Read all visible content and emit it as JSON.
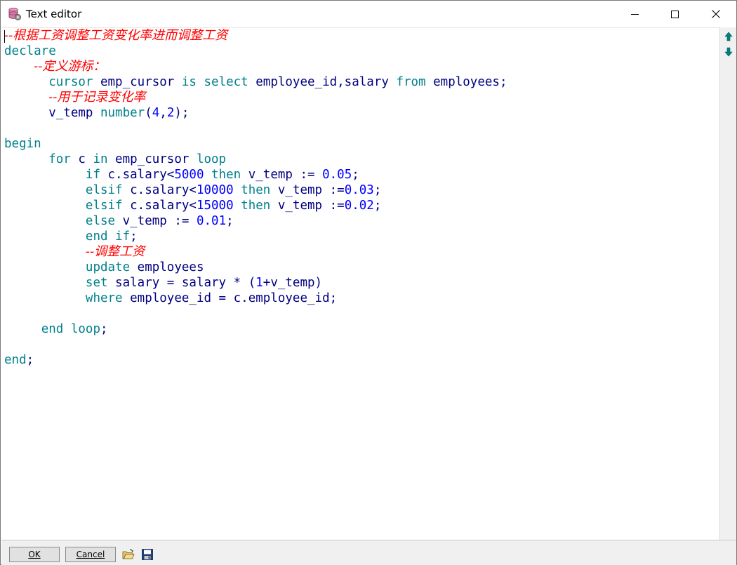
{
  "window": {
    "title": "Text editor",
    "icon": "database-icon"
  },
  "editor": {
    "lines": [
      {
        "indent": "",
        "segments": [
          {
            "t": "--根据工资调整工资变化率进而调整工资",
            "c": "cmt"
          }
        ]
      },
      {
        "indent": "",
        "segments": [
          {
            "t": "declare",
            "c": "kw"
          }
        ]
      },
      {
        "indent": "    ",
        "segments": [
          {
            "t": "--定义游标：",
            "c": "cmt"
          }
        ]
      },
      {
        "indent": "      ",
        "segments": [
          {
            "t": "cursor",
            "c": "kw"
          },
          {
            "t": " emp_cursor ",
            "c": "id"
          },
          {
            "t": "is",
            "c": "kw"
          },
          {
            "t": " ",
            "c": "id"
          },
          {
            "t": "select",
            "c": "kw"
          },
          {
            "t": " employee_id,salary ",
            "c": "id"
          },
          {
            "t": "from",
            "c": "kw"
          },
          {
            "t": " employees;",
            "c": "id"
          }
        ]
      },
      {
        "indent": "      ",
        "segments": [
          {
            "t": "--用于记录变化率",
            "c": "cmt"
          }
        ]
      },
      {
        "indent": "      ",
        "segments": [
          {
            "t": "v_temp ",
            "c": "id"
          },
          {
            "t": "number",
            "c": "kw"
          },
          {
            "t": "(",
            "c": "id"
          },
          {
            "t": "4",
            "c": "num"
          },
          {
            "t": ",",
            "c": "id"
          },
          {
            "t": "2",
            "c": "num"
          },
          {
            "t": ");",
            "c": "id"
          }
        ]
      },
      {
        "indent": "",
        "segments": []
      },
      {
        "indent": "",
        "segments": [
          {
            "t": "begin",
            "c": "kw"
          }
        ]
      },
      {
        "indent": "      ",
        "segments": [
          {
            "t": "for",
            "c": "kw"
          },
          {
            "t": " c ",
            "c": "id"
          },
          {
            "t": "in",
            "c": "kw"
          },
          {
            "t": " emp_cursor ",
            "c": "id"
          },
          {
            "t": "loop",
            "c": "kw"
          }
        ]
      },
      {
        "indent": "           ",
        "segments": [
          {
            "t": "if",
            "c": "kw"
          },
          {
            "t": " c.salary<",
            "c": "id"
          },
          {
            "t": "5000",
            "c": "num"
          },
          {
            "t": " ",
            "c": "id"
          },
          {
            "t": "then",
            "c": "kw"
          },
          {
            "t": " v_temp := ",
            "c": "id"
          },
          {
            "t": "0.05",
            "c": "num"
          },
          {
            "t": ";",
            "c": "id"
          }
        ]
      },
      {
        "indent": "           ",
        "segments": [
          {
            "t": "elsif",
            "c": "kw"
          },
          {
            "t": " c.salary<",
            "c": "id"
          },
          {
            "t": "10000",
            "c": "num"
          },
          {
            "t": " ",
            "c": "id"
          },
          {
            "t": "then",
            "c": "kw"
          },
          {
            "t": " v_temp :=",
            "c": "id"
          },
          {
            "t": "0.03",
            "c": "num"
          },
          {
            "t": ";",
            "c": "id"
          }
        ]
      },
      {
        "indent": "           ",
        "segments": [
          {
            "t": "elsif",
            "c": "kw"
          },
          {
            "t": " c.salary<",
            "c": "id"
          },
          {
            "t": "15000",
            "c": "num"
          },
          {
            "t": " ",
            "c": "id"
          },
          {
            "t": "then",
            "c": "kw"
          },
          {
            "t": " v_temp :=",
            "c": "id"
          },
          {
            "t": "0.02",
            "c": "num"
          },
          {
            "t": ";",
            "c": "id"
          }
        ]
      },
      {
        "indent": "           ",
        "segments": [
          {
            "t": "else",
            "c": "kw"
          },
          {
            "t": " v_temp := ",
            "c": "id"
          },
          {
            "t": "0.01",
            "c": "num"
          },
          {
            "t": ";",
            "c": "id"
          }
        ]
      },
      {
        "indent": "           ",
        "segments": [
          {
            "t": "end",
            "c": "kw"
          },
          {
            "t": " ",
            "c": "id"
          },
          {
            "t": "if",
            "c": "kw"
          },
          {
            "t": ";",
            "c": "id"
          }
        ]
      },
      {
        "indent": "           ",
        "segments": [
          {
            "t": "--调整工资",
            "c": "cmt"
          }
        ]
      },
      {
        "indent": "           ",
        "segments": [
          {
            "t": "update",
            "c": "kw"
          },
          {
            "t": " employees",
            "c": "id"
          }
        ]
      },
      {
        "indent": "           ",
        "segments": [
          {
            "t": "set",
            "c": "kw"
          },
          {
            "t": " salary = salary * (",
            "c": "id"
          },
          {
            "t": "1",
            "c": "num"
          },
          {
            "t": "+v_temp)",
            "c": "id"
          }
        ]
      },
      {
        "indent": "           ",
        "segments": [
          {
            "t": "where",
            "c": "kw"
          },
          {
            "t": " employee_id = c.employee_id;",
            "c": "id"
          }
        ]
      },
      {
        "indent": "",
        "segments": []
      },
      {
        "indent": "     ",
        "segments": [
          {
            "t": "end",
            "c": "kw"
          },
          {
            "t": " ",
            "c": "id"
          },
          {
            "t": "loop",
            "c": "kw"
          },
          {
            "t": ";",
            "c": "id"
          }
        ]
      },
      {
        "indent": "",
        "segments": []
      },
      {
        "indent": "",
        "segments": [
          {
            "t": "end",
            "c": "kw"
          },
          {
            "t": ";",
            "c": "id"
          }
        ]
      }
    ]
  },
  "gutter": {
    "up_icon": "arrow-up-icon",
    "down_icon": "arrow-down-icon"
  },
  "toolbar": {
    "ok_label": "OK",
    "cancel_label": "Cancel",
    "open_icon": "open-folder-icon",
    "save_icon": "save-icon"
  },
  "colors": {
    "comment": "#ff0000",
    "keyword": "#00808b",
    "identifier": "#000080",
    "number": "#0000ff",
    "toolbar_bg": "#f0f0f0"
  }
}
